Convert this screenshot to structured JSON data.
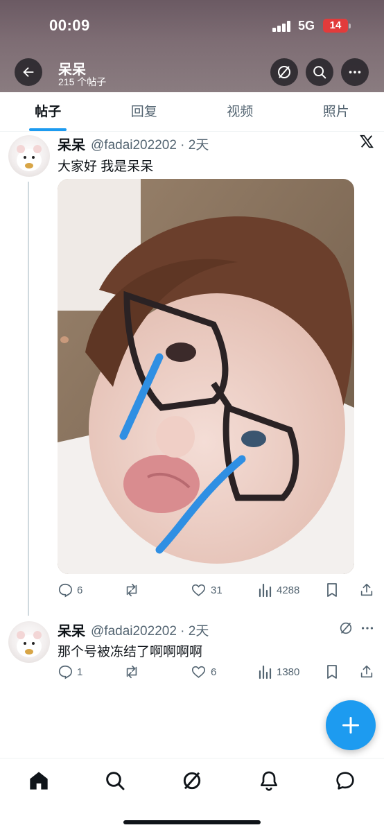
{
  "status_bar": {
    "time": "00:09",
    "network": "5G",
    "battery": "14"
  },
  "header": {
    "name": "呆呆",
    "post_count": "215 个帖子"
  },
  "tabs": [
    {
      "label": "帖子",
      "active": true
    },
    {
      "label": "回复",
      "active": false
    },
    {
      "label": "视频",
      "active": false
    },
    {
      "label": "照片",
      "active": false
    }
  ],
  "tweets": [
    {
      "name": "呆呆",
      "handle_time": "@fadai202202 · 2天",
      "text": "大家好 我是呆呆",
      "replies": "6",
      "reposts": "",
      "likes": "31",
      "views": "4288",
      "badge_icon": "x-logo-icon"
    },
    {
      "name": "呆呆",
      "handle_time": "@fadai202202 · 2天",
      "text": "那个号被冻结了啊啊啊啊",
      "replies": "1",
      "reposts": "",
      "likes": "6",
      "views": "1380",
      "badge_icon": "grok-icon"
    }
  ],
  "colors": {
    "accent": "#1d9bf0",
    "text": "#0f1419",
    "muted": "#536471"
  }
}
